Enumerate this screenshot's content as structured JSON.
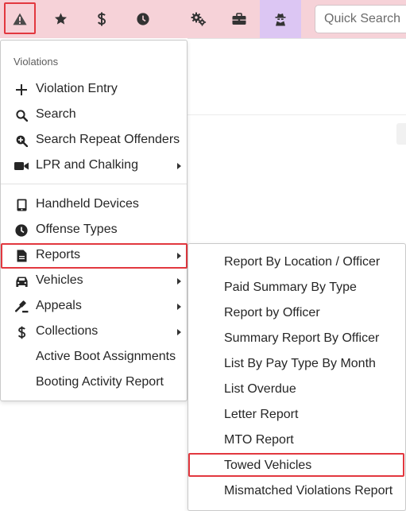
{
  "topbar": {
    "icons": [
      "warning-icon",
      "star-icon",
      "dollar-icon",
      "clock-icon",
      "gears-icon",
      "briefcase-icon",
      "spy-icon"
    ],
    "search_placeholder": "Quick Search",
    "active_color": "#dcc6f3",
    "bar_color": "#f6d2d8"
  },
  "highlight_color": "#e2383f",
  "menu": {
    "header": "Violations",
    "items": [
      {
        "label": "Violation Entry",
        "icon": "plus-icon",
        "submenu": false
      },
      {
        "label": "Search",
        "icon": "search-icon",
        "submenu": false
      },
      {
        "label": "Search Repeat Offenders",
        "icon": "search-plus-icon",
        "submenu": false
      },
      {
        "label": "LPR and Chalking",
        "icon": "video-camera-icon",
        "submenu": true
      },
      {
        "label": "Handheld Devices",
        "icon": "tablet-icon",
        "submenu": false
      },
      {
        "label": "Offense Types",
        "icon": "clock-icon",
        "submenu": false
      },
      {
        "label": "Reports",
        "icon": "file-icon",
        "submenu": true
      },
      {
        "label": "Vehicles",
        "icon": "car-icon",
        "submenu": true
      },
      {
        "label": "Appeals",
        "icon": "gavel-icon",
        "submenu": true
      },
      {
        "label": "Collections",
        "icon": "dollar-icon",
        "submenu": true
      },
      {
        "label": "Active Boot Assignments",
        "icon": "",
        "submenu": false
      },
      {
        "label": "Booting Activity Report",
        "icon": "",
        "submenu": false
      }
    ]
  },
  "submenu": {
    "items": [
      "Report By Location / Officer",
      "Paid Summary By Type",
      "Report by Officer",
      "Summary Report By Officer",
      "List By Pay Type By Month",
      "List Overdue",
      "Letter Report",
      "MTO Report",
      "Towed Vehicles",
      "Mismatched Violations Report"
    ]
  }
}
